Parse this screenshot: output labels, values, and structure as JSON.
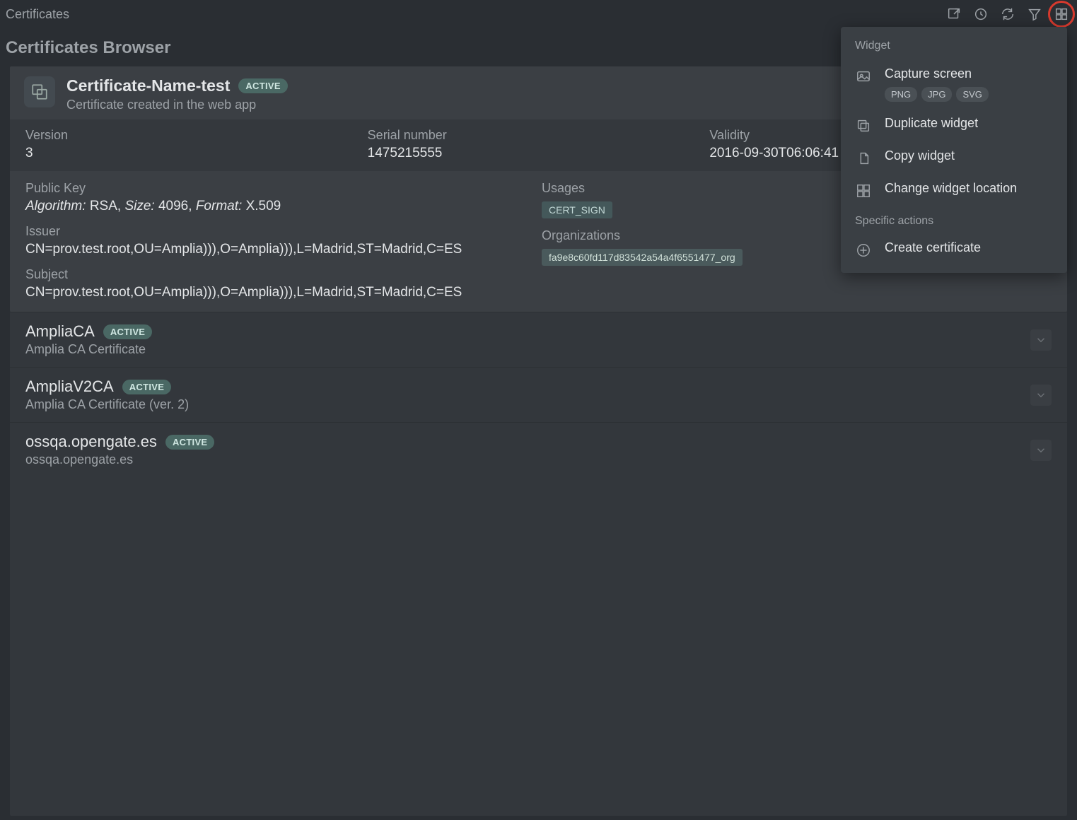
{
  "header": {
    "title": "Certificates"
  },
  "section_title": "Certificates Browser",
  "menu": {
    "widget_label": "Widget",
    "capture_label": "Capture screen",
    "capture_formats": [
      "PNG",
      "JPG",
      "SVG"
    ],
    "duplicate_label": "Duplicate widget",
    "copy_label": "Copy widget",
    "change_loc_label": "Change widget location",
    "specific_label": "Specific actions",
    "create_cert_label": "Create certificate"
  },
  "expanded": {
    "name": "Certificate-Name-test",
    "status": "ACTIVE",
    "description": "Certificate created in the web app",
    "version_label": "Version",
    "version": "3",
    "serial_label": "Serial number",
    "serial": "1475215555",
    "validity_label": "Validity",
    "validity": "2016-09-30T06:06:41",
    "pubkey_label": "Public Key",
    "pubkey_alg_label": "Algorithm:",
    "pubkey_alg": "RSA",
    "pubkey_size_label": "Size:",
    "pubkey_size": "4096",
    "pubkey_format_label": "Format:",
    "pubkey_format": "X.509",
    "usages_label": "Usages",
    "usages_tag": "CERT_SIGN",
    "issuer_label": "Issuer",
    "issuer": "CN=prov.test.root,OU=Amplia))),O=Amplia))),L=Madrid,ST=Madrid,C=ES",
    "orgs_label": "Organizations",
    "orgs_tag": "fa9e8c60fd117d83542a54a4f6551477_org",
    "subject_label": "Subject",
    "subject": "CN=prov.test.root,OU=Amplia))),O=Amplia))),L=Madrid,ST=Madrid,C=ES"
  },
  "rows": [
    {
      "name": "AmpliaCA",
      "status": "ACTIVE",
      "sub": "Amplia CA Certificate"
    },
    {
      "name": "AmpliaV2CA",
      "status": "ACTIVE",
      "sub": "Amplia CA Certificate (ver. 2)"
    },
    {
      "name": "ossqa.opengate.es",
      "status": "ACTIVE",
      "sub": "ossqa.opengate.es"
    }
  ]
}
